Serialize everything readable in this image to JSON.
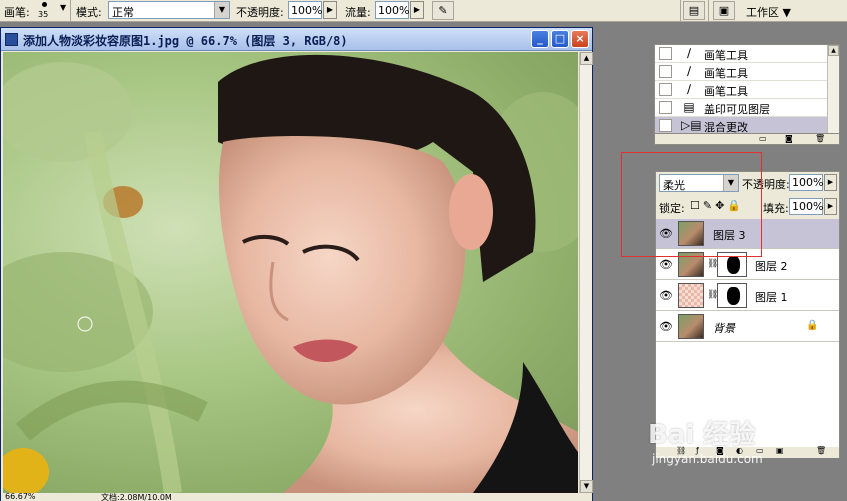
{
  "options_bar": {
    "brush_label": "画笔:",
    "brush_size": "35",
    "mode_label": "模式:",
    "mode_value": "正常",
    "opacity_label": "不透明度:",
    "opacity_value": "100%",
    "flow_label": "流量:",
    "flow_value": "100%",
    "airbrush_icon": "airbrush-icon",
    "workspace_label": "工作区 ▼"
  },
  "document": {
    "title": "添加人物淡彩妆容原图1.jpg @ 66.7% (图层 3, RGB/8)",
    "minimize": "_",
    "maximize": "□",
    "close": "×",
    "zoom": "66.67%",
    "doc_info": "文档:2.08M/10.0M"
  },
  "history": {
    "items": [
      {
        "label": "画笔工具",
        "icon": "brush-icon",
        "active": false
      },
      {
        "label": "画笔工具",
        "icon": "brush-icon",
        "active": false
      },
      {
        "label": "画笔工具",
        "icon": "brush-icon",
        "active": false
      },
      {
        "label": "盖印可见图层",
        "icon": "stamp-icon",
        "active": false
      },
      {
        "label": "混合更改",
        "icon": "blend-icon",
        "active": true
      }
    ]
  },
  "layers_panel": {
    "blend_mode": "柔光",
    "opacity_label": "不透明度:",
    "opacity_value": "100%",
    "lock_label": "锁定:",
    "fill_label": "填充:",
    "fill_value": "100%",
    "layers": [
      {
        "name": "图层 3",
        "selected": true,
        "has_mask": false
      },
      {
        "name": "图层 2",
        "selected": false,
        "has_mask": true
      },
      {
        "name": "图层 1",
        "selected": false,
        "has_mask": true
      },
      {
        "name": "背景",
        "selected": false,
        "has_mask": false,
        "locked": true
      }
    ]
  },
  "watermark": {
    "logo": "Bai 经验",
    "url": "jingyan.baidu.com"
  },
  "colors": {
    "annotation_red": "#e03030",
    "selected_layer": "#c6c3d6",
    "panel_bg": "#ece9d8"
  }
}
